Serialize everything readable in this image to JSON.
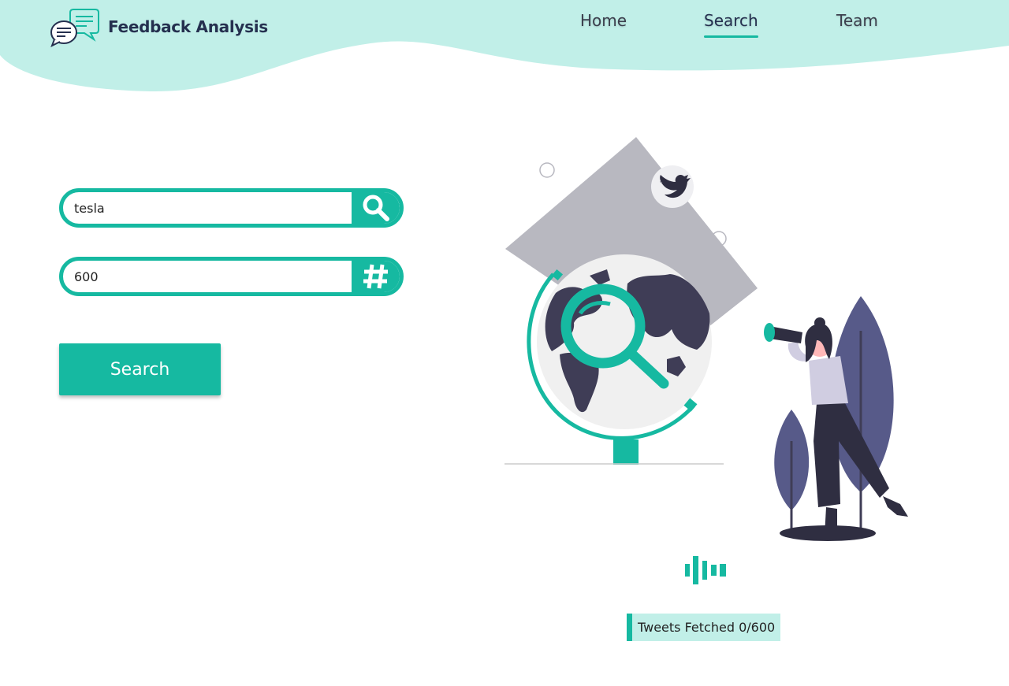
{
  "brand": {
    "title": "Feedback Analysis",
    "logo_icon": "chat-bubbles-icon"
  },
  "nav": {
    "items": [
      "Home",
      "Search",
      "Team"
    ],
    "active": "Search"
  },
  "form": {
    "keyword": {
      "value": "tesla",
      "button_icon": "search-icon"
    },
    "count": {
      "value": "600",
      "button_icon": "hashtag-icon"
    },
    "submit_label": "Search"
  },
  "status": {
    "text": "Tweets Fetched 0/600"
  },
  "colors": {
    "accent": "#16b9a1",
    "header": "#c1efe8",
    "navy": "#25304f",
    "purple": "#575a89",
    "dark": "#2f2e41",
    "gray": "#b8b8c0"
  }
}
